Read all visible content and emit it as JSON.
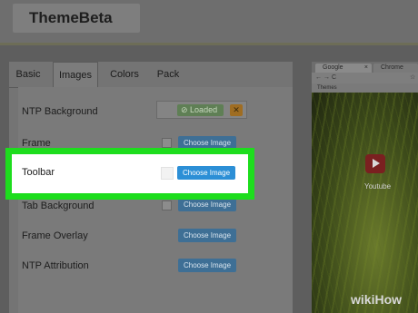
{
  "app": {
    "brand": "ThemeBeta"
  },
  "tabs": [
    {
      "label": "Basic"
    },
    {
      "label": "Images"
    },
    {
      "label": "Colors"
    },
    {
      "label": "Pack"
    }
  ],
  "rows": {
    "ntp_background": {
      "label": "NTP Background",
      "status": "Loaded",
      "remove": "✕"
    },
    "frame": {
      "label": "Frame",
      "button": "Choose Image"
    },
    "toolbar": {
      "label": "Toolbar",
      "button": "Choose Image"
    },
    "tab_background": {
      "label": "Tab Background",
      "button": "Choose Image"
    },
    "frame_overlay": {
      "label": "Frame Overlay",
      "button": "Choose Image"
    },
    "ntp_attribution": {
      "label": "NTP Attribution",
      "button": "Choose Image"
    }
  },
  "preview": {
    "tab1": "Google",
    "tab2": "Chrome",
    "tab_close": "×",
    "bookmark": "Themes",
    "nav_glyphs": [
      "←",
      "→",
      "C",
      "☆"
    ],
    "video_label": "Youtube"
  },
  "colors": {
    "highlight": "#1ddd1d",
    "button_blue": "#2c8fd6"
  },
  "watermark": "wikiHow"
}
